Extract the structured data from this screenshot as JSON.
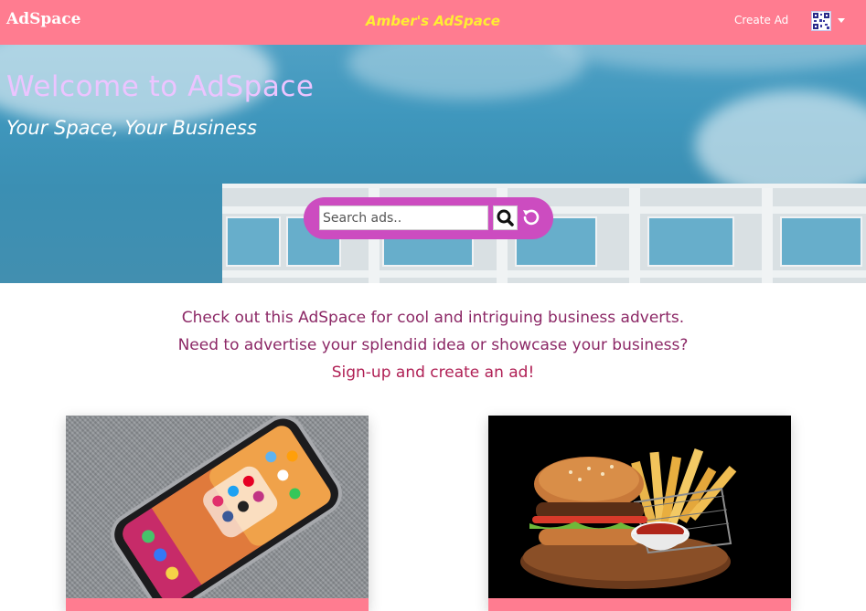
{
  "navbar": {
    "brand": "AdSpace",
    "center_title": "Amber's AdSpace",
    "create_ad_label": "Create Ad",
    "avatar_icon": "qr-avatar-icon",
    "accent_color": "#ff7c90",
    "title_color": "#ffee33"
  },
  "hero": {
    "title": "Welcome to AdSpace",
    "subtitle": "Your Space, Your Business",
    "search": {
      "placeholder": "Search ads..",
      "value": "",
      "search_icon": "search-icon",
      "reset_icon": "reset-icon"
    },
    "pill_color": "#cc4cc0"
  },
  "intro": {
    "line1": "Check out this AdSpace for cool and intriguing business adverts.",
    "line2": "Need to advertise your splendid idea or showcase your business?",
    "line3": "Sign-up and create an ad!"
  },
  "cards": [
    {
      "image": "smartphone-social-media-photo",
      "footer_color": "#ff7c90"
    },
    {
      "image": "burger-and-fries-photo",
      "footer_color": "#ff7c90"
    }
  ]
}
